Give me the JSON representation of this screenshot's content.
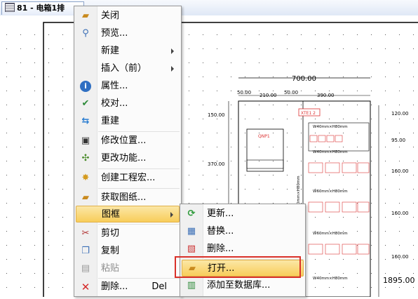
{
  "tab": {
    "title": "81 - 电箱1排"
  },
  "drawing": {
    "dims": {
      "total_width": "700.00",
      "d1": "50.00",
      "d2": "210.00",
      "d3": "50.00",
      "d4": "390.00",
      "h1": "150.00",
      "h2": "370.00",
      "r1": "120.00",
      "r2": "95.00",
      "r3": "160.00",
      "r4": "160.00",
      "r5": "160.00",
      "bottom": "1895.00"
    },
    "labels": {
      "xte": "XTE1 2",
      "qnp": "QNP1",
      "rail1": "W40mm×H80mm",
      "rail2": "W40mm×H80mm",
      "rail3": "W60mm×H80mm",
      "rail4": "W60mm×H80mm",
      "rail5": "W40mm×H80mm",
      "vertical": "W20mm×H80mm"
    }
  },
  "context_menu": {
    "items": [
      {
        "label": "关闭",
        "icon": "folder-open-icon"
      },
      {
        "label": "预览...",
        "icon": "magnifier-icon"
      },
      {
        "label": "新建",
        "submenu": true
      },
      {
        "label": "插入（前）",
        "submenu": true
      },
      {
        "label": "属性...",
        "icon": "info-icon"
      },
      {
        "label": "校对...",
        "icon": "check-icon"
      },
      {
        "label": "重建",
        "icon": "rebuild-icon"
      },
      {
        "label": "修改位置...",
        "icon": "position-icon"
      },
      {
        "label": "更改功能...",
        "icon": "function-icon"
      },
      {
        "label": "创建工程宏...",
        "icon": "macro-icon"
      },
      {
        "label": "获取图纸...",
        "icon": "fetch-drawing-icon"
      },
      {
        "label": "图框",
        "submenu": true,
        "active": true
      },
      {
        "label": "剪切",
        "icon": "scissors-icon"
      },
      {
        "label": "复制",
        "icon": "copy-icon"
      },
      {
        "label": "粘贴",
        "icon": "paste-icon",
        "disabled": true
      },
      {
        "label": "删除...",
        "icon": "delete-icon",
        "shortcut": "Del"
      }
    ]
  },
  "frame_submenu": {
    "items": [
      {
        "label": "更新...",
        "icon": "refresh-icon"
      },
      {
        "label": "替换...",
        "icon": "replace-icon"
      },
      {
        "label": "删除...",
        "icon": "delete-frame-icon"
      },
      {
        "label": "打开...",
        "icon": "open-frame-icon",
        "active": true
      },
      {
        "label": "添加至数据库...",
        "icon": "add-to-database-icon"
      }
    ]
  },
  "colors": {
    "highlight_box": "#d9312a",
    "menu_active": "#f8cd5a"
  }
}
